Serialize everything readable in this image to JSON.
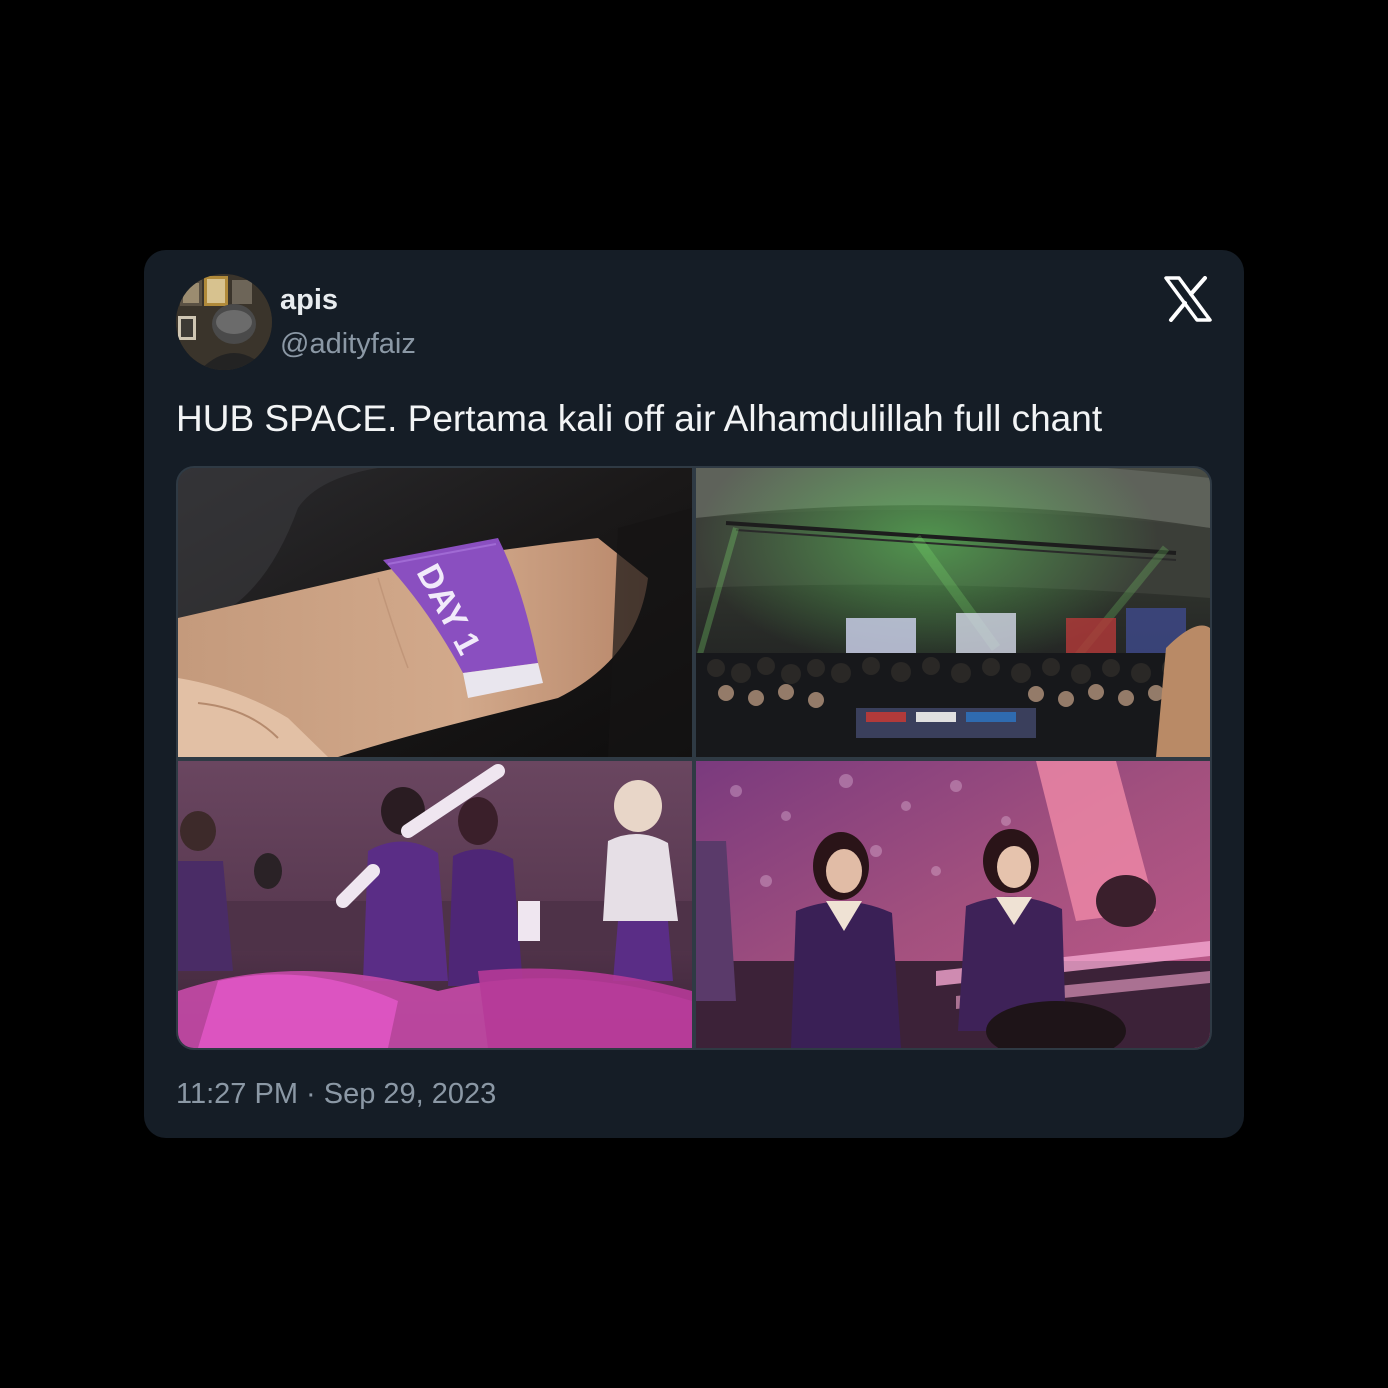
{
  "user": {
    "display_name": "apis",
    "handle": "@adityfaiz"
  },
  "logo_icon": "x-logo-icon",
  "tweet": {
    "text": "HUB SPACE. Pertama kali off air Alhamdulillah full chant",
    "timestamp": "11:27 PM · Sep 29, 2023"
  },
  "media": {
    "wristband_text": "DAY 1"
  },
  "colors": {
    "card_background": "#151d26",
    "page_background": "#000000",
    "primary_text": "#f2f4f5",
    "secondary_text": "#8b98a5",
    "wristband_purple": "#8a4fc0"
  }
}
